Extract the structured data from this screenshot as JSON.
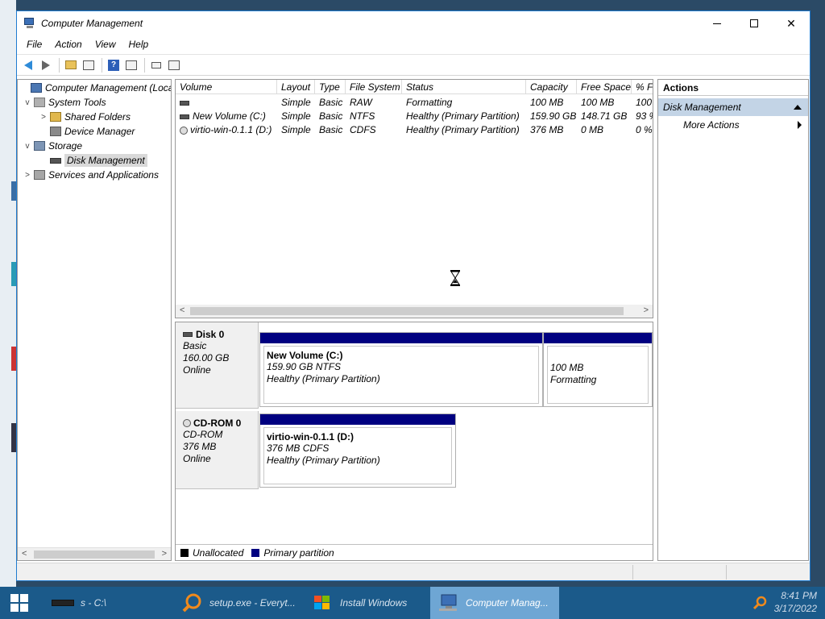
{
  "window": {
    "title": "Computer Management"
  },
  "menu": [
    "File",
    "Action",
    "View",
    "Help"
  ],
  "tree": {
    "items": [
      {
        "label": "Computer Management (Local",
        "level": 0,
        "chev": ""
      },
      {
        "label": "System Tools",
        "level": 1,
        "chev": "v"
      },
      {
        "label": "Shared Folders",
        "level": 2,
        "chev": ">"
      },
      {
        "label": "Device Manager",
        "level": 2,
        "chev": ""
      },
      {
        "label": "Storage",
        "level": 1,
        "chev": "v"
      },
      {
        "label": "Disk Management",
        "level": 2,
        "chev": "",
        "selected": true
      },
      {
        "label": "Services and Applications",
        "level": 1,
        "chev": ">"
      }
    ]
  },
  "list": {
    "columns": [
      "Volume",
      "Layout",
      "Type",
      "File System",
      "Status",
      "Capacity",
      "Free Space",
      "% F"
    ],
    "rows": [
      {
        "volume": "",
        "layout": "Simple",
        "type": "Basic",
        "fs": "RAW",
        "status": "Formatting",
        "capacity": "100 MB",
        "free": "100 MB",
        "pct": "100"
      },
      {
        "volume": "New Volume (C:)",
        "layout": "Simple",
        "type": "Basic",
        "fs": "NTFS",
        "status": "Healthy (Primary Partition)",
        "capacity": "159.90 GB",
        "free": "148.71 GB",
        "pct": "93 %"
      },
      {
        "volume": "virtio-win-0.1.1 (D:)",
        "layout": "Simple",
        "type": "Basic",
        "fs": "CDFS",
        "status": "Healthy (Primary Partition)",
        "capacity": "376 MB",
        "free": "0 MB",
        "pct": "0 %"
      }
    ]
  },
  "disks": [
    {
      "name": "Disk 0",
      "type": "Basic",
      "size": "160.00 GB",
      "state": "Online",
      "partitions": [
        {
          "title": "New Volume  (C:)",
          "line1": "159.90 GB NTFS",
          "line2": "Healthy (Primary Partition)"
        },
        {
          "title": "",
          "line1": "100 MB",
          "line2": "Formatting"
        }
      ]
    },
    {
      "name": "CD-ROM 0",
      "type": "CD-ROM",
      "size": "376 MB",
      "state": "Online",
      "partitions": [
        {
          "title": "virtio-win-0.1.1  (D:)",
          "line1": "376 MB CDFS",
          "line2": "Healthy (Primary Partition)"
        }
      ]
    }
  ],
  "legend": {
    "unallocated": "Unallocated",
    "primary": "Primary partition"
  },
  "colors": {
    "primary": "#000080",
    "unallocated": "#000000",
    "taskbar": "#1b5a8a",
    "actions_section": "#c3d4e6"
  },
  "actions": {
    "header": "Actions",
    "section": "Disk Management",
    "more": "More Actions"
  },
  "taskbar": {
    "items": [
      {
        "label": "s - C:\\"
      },
      {
        "label": "setup.exe - Everyt..."
      },
      {
        "label": "Install Windows"
      },
      {
        "label": "Computer Manag...",
        "active": true
      }
    ],
    "time": "8:41 PM",
    "date": "3/17/2022"
  }
}
